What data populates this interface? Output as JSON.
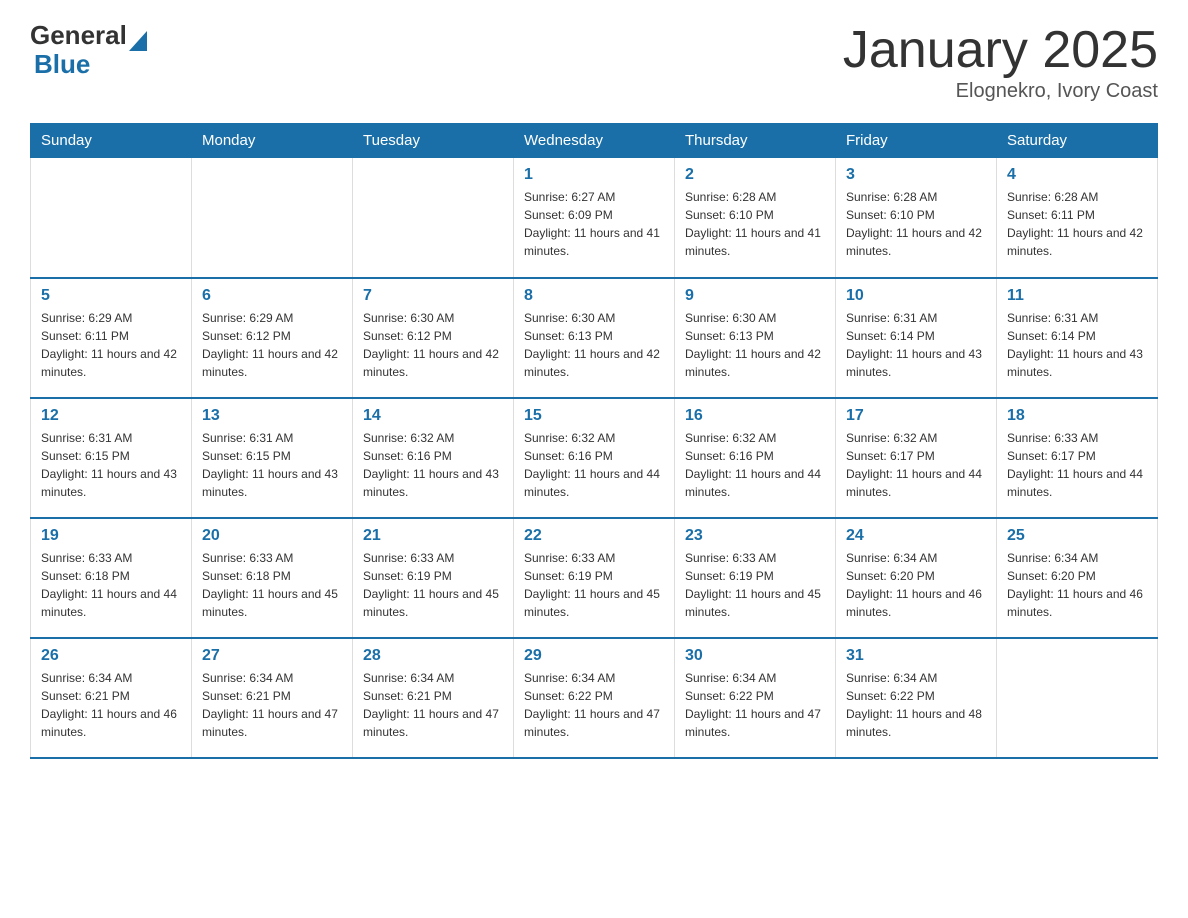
{
  "header": {
    "title": "January 2025",
    "subtitle": "Elognekro, Ivory Coast"
  },
  "logo": {
    "general": "General",
    "blue": "Blue"
  },
  "days_of_week": [
    "Sunday",
    "Monday",
    "Tuesday",
    "Wednesday",
    "Thursday",
    "Friday",
    "Saturday"
  ],
  "weeks": [
    [
      {
        "day": "",
        "info": ""
      },
      {
        "day": "",
        "info": ""
      },
      {
        "day": "",
        "info": ""
      },
      {
        "day": "1",
        "info": "Sunrise: 6:27 AM\nSunset: 6:09 PM\nDaylight: 11 hours and 41 minutes."
      },
      {
        "day": "2",
        "info": "Sunrise: 6:28 AM\nSunset: 6:10 PM\nDaylight: 11 hours and 41 minutes."
      },
      {
        "day": "3",
        "info": "Sunrise: 6:28 AM\nSunset: 6:10 PM\nDaylight: 11 hours and 42 minutes."
      },
      {
        "day": "4",
        "info": "Sunrise: 6:28 AM\nSunset: 6:11 PM\nDaylight: 11 hours and 42 minutes."
      }
    ],
    [
      {
        "day": "5",
        "info": "Sunrise: 6:29 AM\nSunset: 6:11 PM\nDaylight: 11 hours and 42 minutes."
      },
      {
        "day": "6",
        "info": "Sunrise: 6:29 AM\nSunset: 6:12 PM\nDaylight: 11 hours and 42 minutes."
      },
      {
        "day": "7",
        "info": "Sunrise: 6:30 AM\nSunset: 6:12 PM\nDaylight: 11 hours and 42 minutes."
      },
      {
        "day": "8",
        "info": "Sunrise: 6:30 AM\nSunset: 6:13 PM\nDaylight: 11 hours and 42 minutes."
      },
      {
        "day": "9",
        "info": "Sunrise: 6:30 AM\nSunset: 6:13 PM\nDaylight: 11 hours and 42 minutes."
      },
      {
        "day": "10",
        "info": "Sunrise: 6:31 AM\nSunset: 6:14 PM\nDaylight: 11 hours and 43 minutes."
      },
      {
        "day": "11",
        "info": "Sunrise: 6:31 AM\nSunset: 6:14 PM\nDaylight: 11 hours and 43 minutes."
      }
    ],
    [
      {
        "day": "12",
        "info": "Sunrise: 6:31 AM\nSunset: 6:15 PM\nDaylight: 11 hours and 43 minutes."
      },
      {
        "day": "13",
        "info": "Sunrise: 6:31 AM\nSunset: 6:15 PM\nDaylight: 11 hours and 43 minutes."
      },
      {
        "day": "14",
        "info": "Sunrise: 6:32 AM\nSunset: 6:16 PM\nDaylight: 11 hours and 43 minutes."
      },
      {
        "day": "15",
        "info": "Sunrise: 6:32 AM\nSunset: 6:16 PM\nDaylight: 11 hours and 44 minutes."
      },
      {
        "day": "16",
        "info": "Sunrise: 6:32 AM\nSunset: 6:16 PM\nDaylight: 11 hours and 44 minutes."
      },
      {
        "day": "17",
        "info": "Sunrise: 6:32 AM\nSunset: 6:17 PM\nDaylight: 11 hours and 44 minutes."
      },
      {
        "day": "18",
        "info": "Sunrise: 6:33 AM\nSunset: 6:17 PM\nDaylight: 11 hours and 44 minutes."
      }
    ],
    [
      {
        "day": "19",
        "info": "Sunrise: 6:33 AM\nSunset: 6:18 PM\nDaylight: 11 hours and 44 minutes."
      },
      {
        "day": "20",
        "info": "Sunrise: 6:33 AM\nSunset: 6:18 PM\nDaylight: 11 hours and 45 minutes."
      },
      {
        "day": "21",
        "info": "Sunrise: 6:33 AM\nSunset: 6:19 PM\nDaylight: 11 hours and 45 minutes."
      },
      {
        "day": "22",
        "info": "Sunrise: 6:33 AM\nSunset: 6:19 PM\nDaylight: 11 hours and 45 minutes."
      },
      {
        "day": "23",
        "info": "Sunrise: 6:33 AM\nSunset: 6:19 PM\nDaylight: 11 hours and 45 minutes."
      },
      {
        "day": "24",
        "info": "Sunrise: 6:34 AM\nSunset: 6:20 PM\nDaylight: 11 hours and 46 minutes."
      },
      {
        "day": "25",
        "info": "Sunrise: 6:34 AM\nSunset: 6:20 PM\nDaylight: 11 hours and 46 minutes."
      }
    ],
    [
      {
        "day": "26",
        "info": "Sunrise: 6:34 AM\nSunset: 6:21 PM\nDaylight: 11 hours and 46 minutes."
      },
      {
        "day": "27",
        "info": "Sunrise: 6:34 AM\nSunset: 6:21 PM\nDaylight: 11 hours and 47 minutes."
      },
      {
        "day": "28",
        "info": "Sunrise: 6:34 AM\nSunset: 6:21 PM\nDaylight: 11 hours and 47 minutes."
      },
      {
        "day": "29",
        "info": "Sunrise: 6:34 AM\nSunset: 6:22 PM\nDaylight: 11 hours and 47 minutes."
      },
      {
        "day": "30",
        "info": "Sunrise: 6:34 AM\nSunset: 6:22 PM\nDaylight: 11 hours and 47 minutes."
      },
      {
        "day": "31",
        "info": "Sunrise: 6:34 AM\nSunset: 6:22 PM\nDaylight: 11 hours and 48 minutes."
      },
      {
        "day": "",
        "info": ""
      }
    ]
  ]
}
